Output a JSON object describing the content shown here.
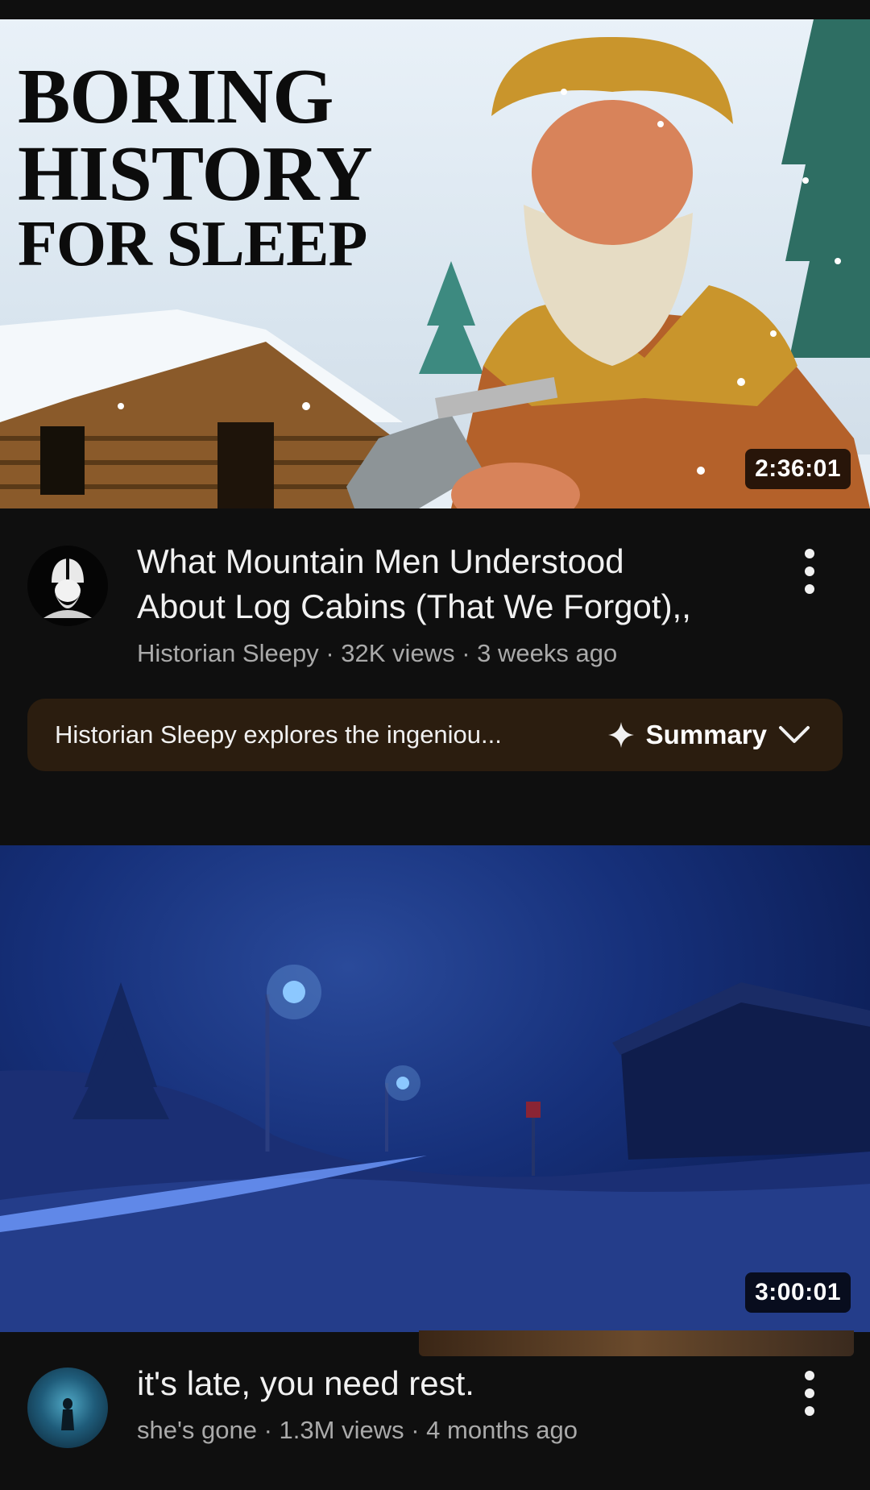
{
  "videos": [
    {
      "thumbnail_overlay": {
        "line1": "BORING",
        "line2": "HISTORY",
        "line3": "FOR SLEEP"
      },
      "duration": "2:36:01",
      "title_line1": "What Mountain Men Understood",
      "title_line2": "About Log Cabins (That We Forgot),,",
      "channel": "Historian Sleepy",
      "views": "32K views",
      "age": "3 weeks ago",
      "summary": {
        "text": "Historian Sleepy explores the ingeniou...",
        "label": "Summary"
      }
    },
    {
      "duration": "3:00:01",
      "title_line1": "it's late, you need rest.",
      "channel": "she's gone",
      "views": "1.3M views",
      "age": "4 months ago"
    }
  ],
  "separator": " · ",
  "icons": {
    "more": "kebab-icon",
    "summary": "sparkle-icon",
    "expand": "chevron-down-icon"
  },
  "colors": {
    "background": "#0f0f0f",
    "summary_bg": "#2b1d0f",
    "secondary_text": "#aaaaaa"
  }
}
